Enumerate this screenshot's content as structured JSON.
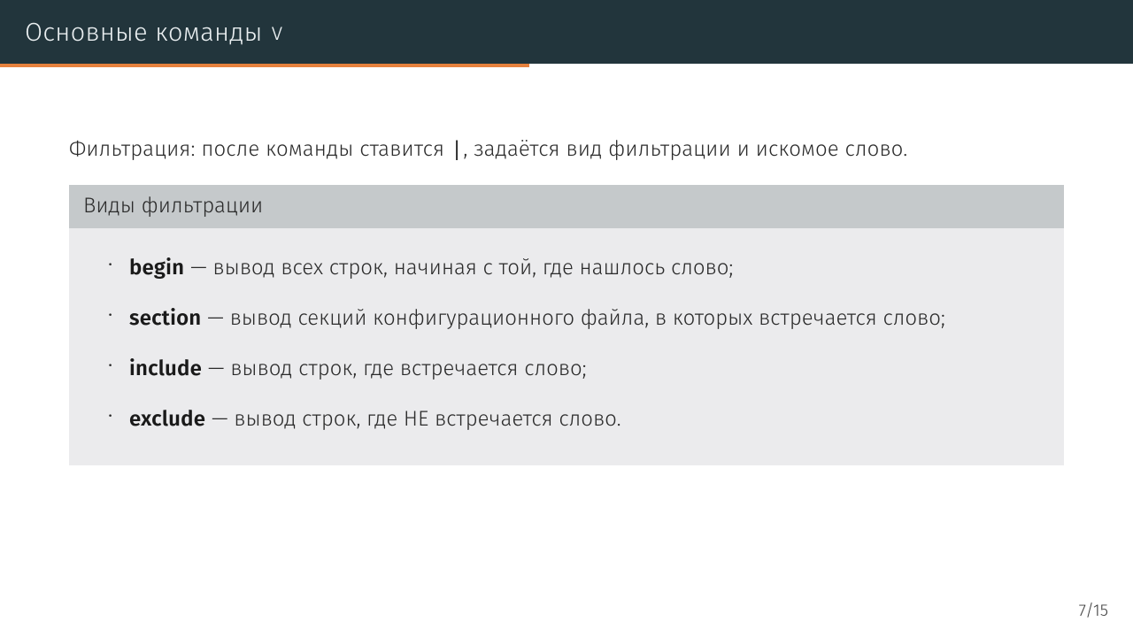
{
  "header": {
    "title": "Основные команды",
    "counter": "v"
  },
  "progress": {
    "percent": 46.7
  },
  "intro": {
    "prefix": "Фильтрация: после команды ставится ",
    "pipe": "|",
    "suffix": ", задаётся вид фильтрации и искомое слово."
  },
  "block": {
    "title": "Виды фильтрации",
    "items": [
      {
        "term": "begin",
        "desc": " — вывод всех строк, начиная с той, где нашлось слово;"
      },
      {
        "term": "section",
        "desc": " — вывод секций конфигурационного файла, в которых встречается слово;"
      },
      {
        "term": "include",
        "desc": " — вывод строк, где встречается слово;"
      },
      {
        "term": "exclude",
        "desc": " — вывод строк, где НЕ встречается слово."
      }
    ]
  },
  "page": {
    "label": "7/15"
  }
}
